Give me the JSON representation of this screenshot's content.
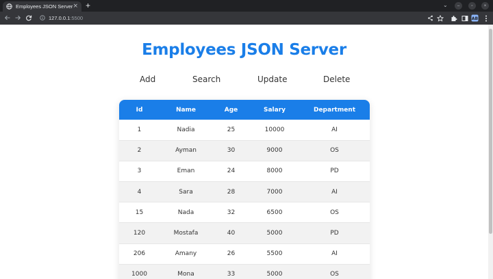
{
  "browser": {
    "tab_title": "Employees JSON Server",
    "tab_close": "×",
    "new_tab": "+",
    "url_host": "127.0.0.1",
    "url_port": ":5500"
  },
  "page": {
    "title": "Employees JSON Server",
    "actions": [
      "Add",
      "Search",
      "Update",
      "Delete"
    ]
  },
  "table": {
    "headers": [
      "Id",
      "Name",
      "Age",
      "Salary",
      "Department"
    ],
    "rows": [
      [
        "1",
        "Nadia",
        "25",
        "10000",
        "AI"
      ],
      [
        "2",
        "Ayman",
        "30",
        "9000",
        "OS"
      ],
      [
        "3",
        "Eman",
        "24",
        "8000",
        "PD"
      ],
      [
        "4",
        "Sara",
        "28",
        "7000",
        "AI"
      ],
      [
        "15",
        "Nada",
        "32",
        "6500",
        "OS"
      ],
      [
        "120",
        "Mostafa",
        "40",
        "5000",
        "PD"
      ],
      [
        "206",
        "Amany",
        "26",
        "5500",
        "AI"
      ],
      [
        "1000",
        "Mona",
        "33",
        "5000",
        "OS"
      ]
    ]
  },
  "colors": {
    "accent": "#1a7ee8",
    "chrome_dark": "#202124",
    "chrome_toolbar": "#35363a",
    "row_alt": "#f2f2f2"
  }
}
